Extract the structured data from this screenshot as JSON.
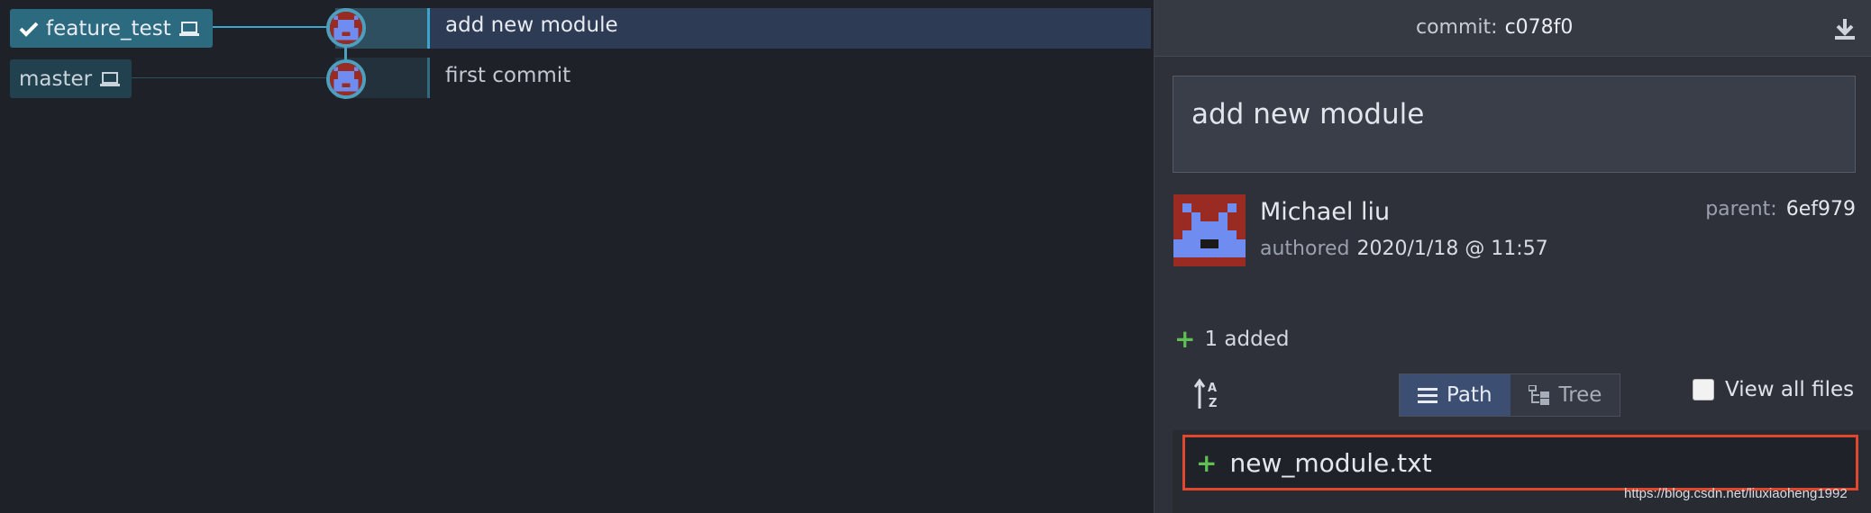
{
  "graph": {
    "branches": [
      {
        "name": "feature_test",
        "active": true
      },
      {
        "name": "master",
        "active": false
      }
    ],
    "commits": [
      {
        "message": "add new module",
        "selected": true
      },
      {
        "message": "first commit",
        "selected": false
      }
    ]
  },
  "details": {
    "title_label": "commit:",
    "sha": "c078f0",
    "summary": "add new module",
    "author": "Michael liu",
    "authored_label": "authored",
    "date": "2020/1/18 @ 11:57",
    "parent_label": "parent:",
    "parent_sha": "6ef979",
    "added_summary": "1 added",
    "toggle": {
      "path_label": "Path",
      "tree_label": "Tree",
      "selected": "Path"
    },
    "view_all_label": "View all files",
    "view_all_checked": false,
    "files": [
      {
        "name": "new_module.txt",
        "status": "added"
      }
    ]
  },
  "watermark": "https://blog.csdn.net/liuxiaoheng1992",
  "colors": {
    "accent": "#3aa6cf",
    "added": "#5fbf52",
    "highlight_border": "#e0472d",
    "avatar_bg": "#9a2b22",
    "avatar_fg": "#6f8cf0"
  },
  "icons": [
    "check-icon",
    "laptop-icon",
    "download-icon",
    "sort-az-icon",
    "list-icon",
    "tree-icon",
    "plus-icon"
  ]
}
